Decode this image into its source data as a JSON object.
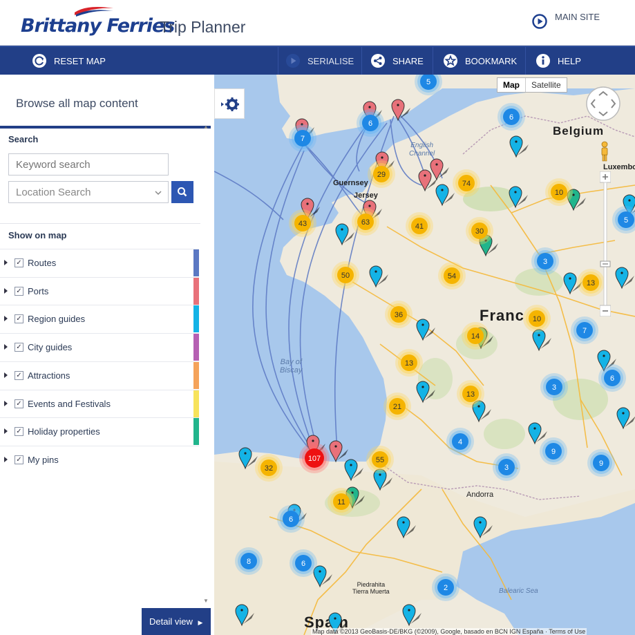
{
  "header": {
    "brand": "Brittany Ferries",
    "app_title": "Trip Planner",
    "main_site_label": "MAIN SITE"
  },
  "toolbar": {
    "reset_label": "RESET MAP",
    "serialise_label": "SERIALISE",
    "share_label": "SHARE",
    "bookmark_label": "BOOKMARK",
    "help_label": "HELP"
  },
  "sidebar": {
    "browse_label": "Browse all map content",
    "search_title": "Search",
    "keyword_placeholder": "Keyword search",
    "location_placeholder": "Location Search",
    "show_title": "Show on map",
    "layers": [
      {
        "label": "Routes",
        "checked": true,
        "color": "#5b78c3"
      },
      {
        "label": "Ports",
        "checked": true,
        "color": "#e8717a"
      },
      {
        "label": "Region guides",
        "checked": true,
        "color": "#14b3e6"
      },
      {
        "label": "City guides",
        "checked": true,
        "color": "#b660b3"
      },
      {
        "label": "Attractions",
        "checked": true,
        "color": "#f5a35a"
      },
      {
        "label": "Events and Festivals",
        "checked": true,
        "color": "#f7e35b"
      },
      {
        "label": "Holiday properties",
        "checked": true,
        "color": "#21b58c"
      },
      {
        "label": "My pins",
        "checked": true,
        "color": "#ffffff"
      }
    ],
    "detail_button": "Detail view"
  },
  "map": {
    "type_options": [
      "Map",
      "Satellite"
    ],
    "selected_type": "Map",
    "labels": {
      "english_channel": "English\nChannel",
      "guernsey": "Guernsey",
      "jersey": "Jersey",
      "bay_of_biscay": "Bay of\nBiscay",
      "belgium": "Belgium",
      "luxembourg": "Luxembo",
      "france": "Franc",
      "andorra": "Andorra",
      "balearic_sea": "Balearic Sea",
      "spain": "Spain",
      "tierra_muerta": "Piedrahita\nTierra Muerta"
    },
    "copyright": "Map data ©2013 GeoBasis-DE/BKG (©2009), Google, basado en BCN IGN España · Terms of Use",
    "clusters": [
      {
        "n": "5",
        "color": "blue"
      },
      {
        "n": "6",
        "color": "blue"
      },
      {
        "n": "7",
        "color": "blue"
      },
      {
        "n": "6",
        "color": "blue"
      },
      {
        "n": "29",
        "color": "orange"
      },
      {
        "n": "74",
        "color": "orange"
      },
      {
        "n": "10",
        "color": "orange"
      },
      {
        "n": "43",
        "color": "orange"
      },
      {
        "n": "63",
        "color": "orange"
      },
      {
        "n": "41",
        "color": "orange"
      },
      {
        "n": "30",
        "color": "orange"
      },
      {
        "n": "5",
        "color": "blue"
      },
      {
        "n": "3",
        "color": "blue"
      },
      {
        "n": "50",
        "color": "orange"
      },
      {
        "n": "54",
        "color": "orange"
      },
      {
        "n": "13",
        "color": "orange"
      },
      {
        "n": "36",
        "color": "orange"
      },
      {
        "n": "10",
        "color": "orange"
      },
      {
        "n": "14",
        "color": "orange"
      },
      {
        "n": "7",
        "color": "blue"
      },
      {
        "n": "13",
        "color": "orange"
      },
      {
        "n": "3",
        "color": "blue"
      },
      {
        "n": "6",
        "color": "blue"
      },
      {
        "n": "13",
        "color": "orange"
      },
      {
        "n": "21",
        "color": "orange"
      },
      {
        "n": "4",
        "color": "blue"
      },
      {
        "n": "9",
        "color": "blue"
      },
      {
        "n": "107",
        "color": "red"
      },
      {
        "n": "55",
        "color": "orange"
      },
      {
        "n": "32",
        "color": "orange"
      },
      {
        "n": "3",
        "color": "blue"
      },
      {
        "n": "9",
        "color": "blue"
      },
      {
        "n": "11",
        "color": "orange"
      },
      {
        "n": "6",
        "color": "blue"
      },
      {
        "n": "8",
        "color": "blue"
      },
      {
        "n": "6",
        "color": "blue"
      },
      {
        "n": "2",
        "color": "blue"
      }
    ]
  }
}
